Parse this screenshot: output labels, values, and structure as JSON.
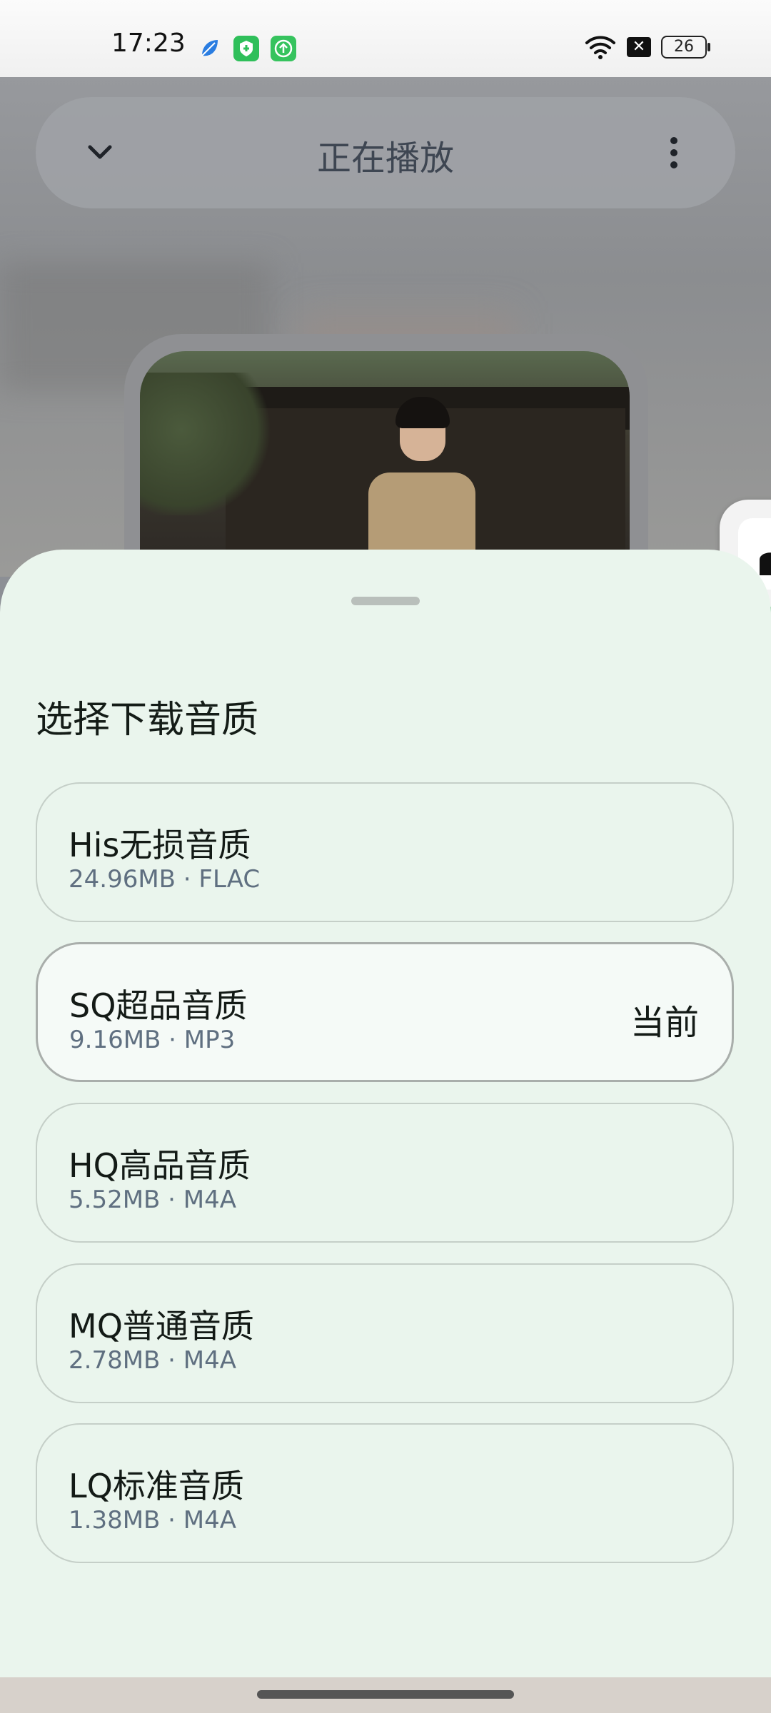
{
  "status_bar": {
    "time": "17:23",
    "battery": "26"
  },
  "player": {
    "title": "正在播放"
  },
  "sheet": {
    "title": "选择下载音质",
    "options": [
      {
        "name": "His无损音质",
        "meta": "24.96MB · FLAC",
        "current_label": ""
      },
      {
        "name": "SQ超品音质",
        "meta": "9.16MB · MP3",
        "current_label": "当前"
      },
      {
        "name": "HQ高品音质",
        "meta": "5.52MB · M4A",
        "current_label": ""
      },
      {
        "name": "MQ普通音质",
        "meta": "2.78MB · M4A",
        "current_label": ""
      },
      {
        "name": "LQ标准音质",
        "meta": "1.38MB · M4A",
        "current_label": ""
      }
    ]
  },
  "icons": {
    "collapse": "chevron-down-icon",
    "more": "more-vertical-icon",
    "wifi": "wifi-icon",
    "battery": "battery-icon"
  }
}
